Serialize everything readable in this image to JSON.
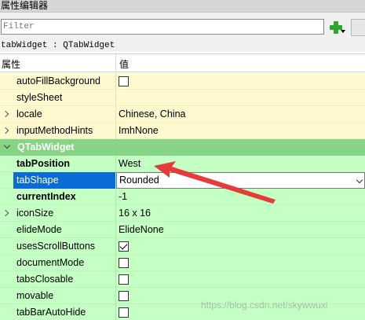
{
  "panel": {
    "title": "属性编辑器"
  },
  "filter": {
    "placeholder": "Filter",
    "value": ""
  },
  "toolbar": {
    "add_icon": "plus-icon",
    "add_color": "#2ea52e"
  },
  "object": {
    "label": "tabWidget : QTabWidget"
  },
  "header": {
    "property": "属性",
    "value": "值"
  },
  "colors": {
    "qwidget_row": "#fff9cf",
    "qtabwidget_row": "#c4ffc4",
    "section": "#87d487",
    "selection": "#0a6bd6",
    "arrow": "#e53b3b"
  },
  "qwidget_rows": [
    {
      "name": "autoFillBackground",
      "value": "",
      "checkbox": true,
      "checked": false
    },
    {
      "name": "styleSheet",
      "value": ""
    },
    {
      "name": "locale",
      "value": "Chinese, China",
      "expandable": true
    },
    {
      "name": "inputMethodHints",
      "value": "ImhNone",
      "expandable": true
    }
  ],
  "section": {
    "title": "QTabWidget"
  },
  "qtabwidget_rows": [
    {
      "name": "tabPosition",
      "value": "West",
      "bold": true
    },
    {
      "name": "tabShape",
      "value": "Rounded",
      "selected": true,
      "combo": true
    },
    {
      "name": "currentIndex",
      "value": "-1",
      "bold": true
    },
    {
      "name": "iconSize",
      "value": "16 x 16",
      "expandable": true
    },
    {
      "name": "elideMode",
      "value": "ElideNone"
    },
    {
      "name": "usesScrollButtons",
      "checkbox": true,
      "checked": true
    },
    {
      "name": "documentMode",
      "checkbox": true,
      "checked": false
    },
    {
      "name": "tabsClosable",
      "checkbox": true,
      "checked": false
    },
    {
      "name": "movable",
      "checkbox": true,
      "checked": false
    },
    {
      "name": "tabBarAutoHide",
      "checkbox": true,
      "checked": false
    }
  ],
  "watermark": "https://blog.csdn.net/skywwuxi"
}
